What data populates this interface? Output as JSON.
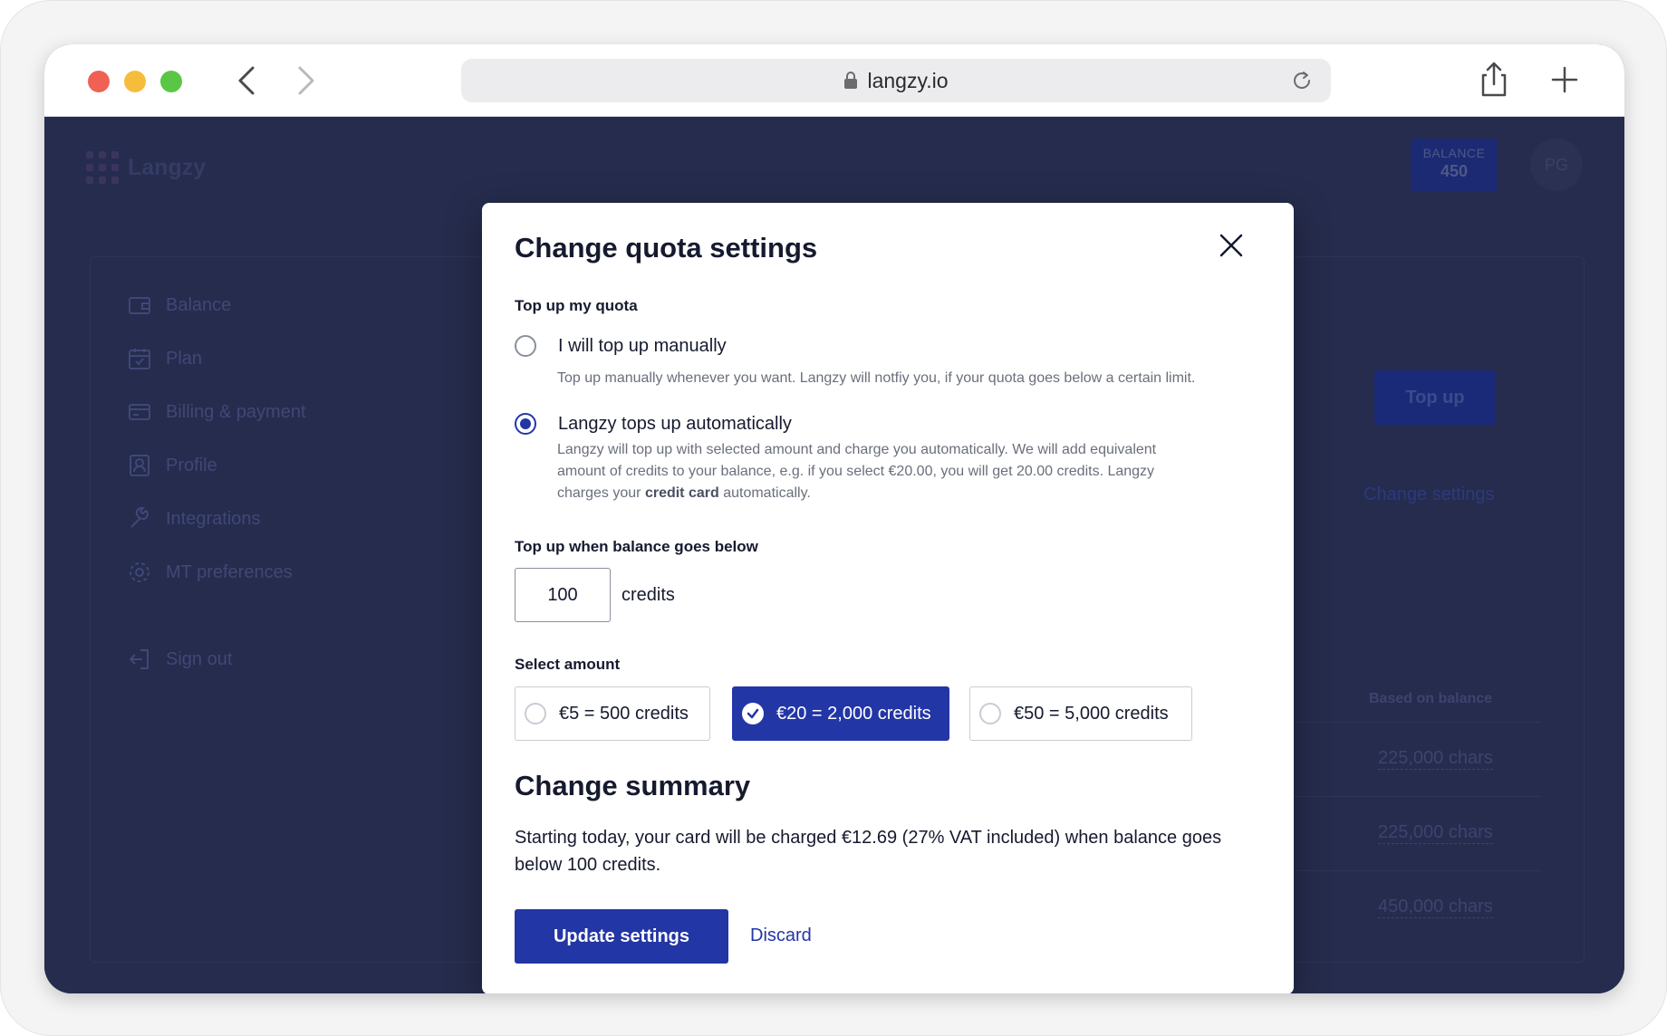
{
  "browser": {
    "url": "langzy.io"
  },
  "app": {
    "logo_text": "Langzy",
    "balance_label": "BALANCE",
    "balance_value": "450",
    "avatar_initials": "PG",
    "sidebar": [
      {
        "label": "Balance",
        "icon": "wallet-icon"
      },
      {
        "label": "Plan",
        "icon": "calendar-icon"
      },
      {
        "label": "Billing & payment",
        "icon": "credit-card-icon"
      },
      {
        "label": "Profile",
        "icon": "user-badge-icon"
      },
      {
        "label": "Integrations",
        "icon": "wrench-icon"
      },
      {
        "label": "MT preferences",
        "icon": "gear-icon"
      },
      {
        "label": "Sign out",
        "icon": "sign-out-icon"
      }
    ],
    "topup_button": "Top up",
    "change_settings_link": "Change settings",
    "table_header": "Based on balance",
    "rows": [
      "225,000 chars",
      "225,000 chars",
      "450,000 chars"
    ]
  },
  "modal": {
    "title": "Change quota settings",
    "topup_section_label": "Top up my quota",
    "options": [
      {
        "label": "I will top up manually",
        "desc": "Top up manually whenever you want. Langzy will notfiy you, if your quota goes below a certain limit.",
        "selected": false
      },
      {
        "label": "Langzy tops up automatically",
        "desc_line1": "Langzy will top up with selected amount and charge you automatically. We will add equivalent",
        "desc_line2": "amount of credits to your balance, e.g. if you select €20.00, you will get 20.00 credits.  Langzy",
        "desc_line3_pre": "charges your ",
        "desc_line3_bold": "credit card",
        "desc_line3_post": " automatically.",
        "selected": true
      }
    ],
    "threshold_label": "Top up when balance goes below",
    "threshold_value": "100",
    "threshold_unit": "credits",
    "amount_label": "Select amount",
    "amounts": [
      {
        "label": "€5 = 500 credits",
        "selected": false
      },
      {
        "label": "€20 = 2,000 credits",
        "selected": true
      },
      {
        "label": "€50  = 5,000 credits",
        "selected": false
      }
    ],
    "summary_title": "Change summary",
    "summary_text": "Starting today, your card will be charged €12.69 (27% VAT included) when balance goes below 100 credits.",
    "update_button": "Update settings",
    "discard_link": "Discard"
  },
  "colors": {
    "primary": "#2336a5",
    "overlay_bg": "#262c4d"
  }
}
